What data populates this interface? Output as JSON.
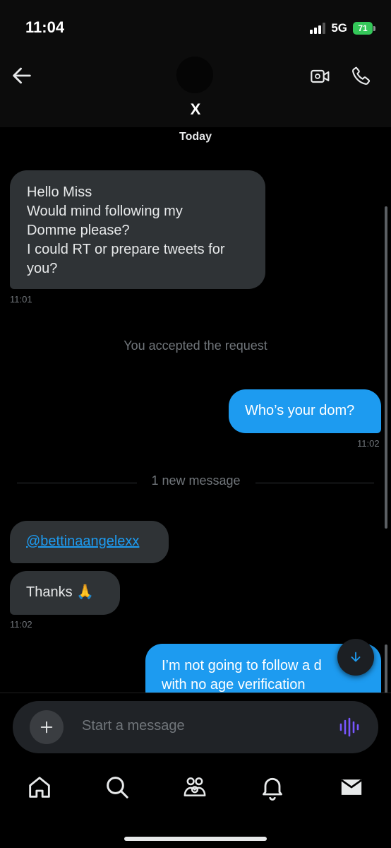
{
  "status_bar": {
    "time": "11:04",
    "network": "5G",
    "battery": "71"
  },
  "header": {
    "contact_name": "X",
    "icons": {
      "back": "arrow-left-icon",
      "video": "video-camera-icon",
      "call": "phone-icon"
    }
  },
  "conversation": {
    "date_divider": "Today",
    "message_1": {
      "lines": [
        "Hello Miss",
        "Would mind following my",
        "Domme please?",
        "I could RT or prepare tweets for",
        "you?"
      ],
      "time": "11:01"
    },
    "system_notice": "You accepted the request",
    "message_2": {
      "text": "Who’s your dom?",
      "time": "11:02"
    },
    "new_message_divider": "1 new message",
    "message_3": {
      "mention": "@bettinaangelexx"
    },
    "message_4": {
      "text": "Thanks 🙏",
      "time": "11:02"
    },
    "message_5": {
      "lines": [
        "I’m not going to follow a d",
        "with no age verification"
      ]
    }
  },
  "composer": {
    "placeholder": "Start a message",
    "icons": {
      "add": "plus-icon",
      "voice": "voice-waveform-icon"
    }
  },
  "tab_bar": {
    "items": [
      {
        "icon": "home-icon"
      },
      {
        "icon": "search-icon"
      },
      {
        "icon": "communities-icon"
      },
      {
        "icon": "notifications-bell-icon"
      },
      {
        "icon": "messages-envelope-icon"
      }
    ]
  },
  "colors": {
    "background": "#000000",
    "incoming_bubble": "#2f3336",
    "outgoing_bubble": "#1d9bf0",
    "muted_text": "#71767b",
    "accent": "#1d9bf0",
    "voice_icon": "#7856ff",
    "battery": "#34c759"
  }
}
